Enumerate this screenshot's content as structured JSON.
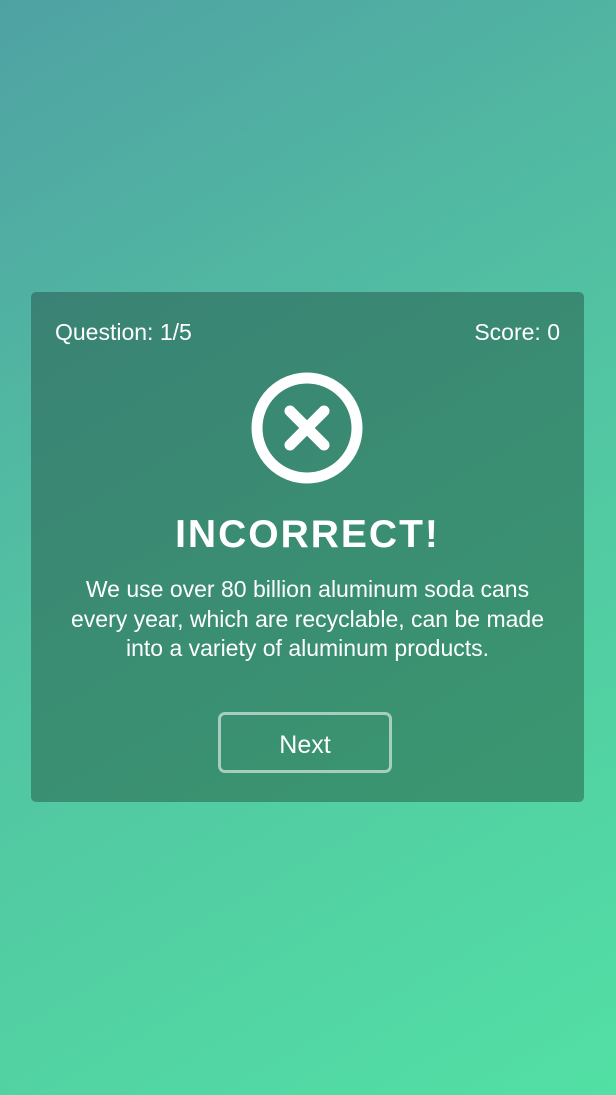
{
  "header": {
    "question_label": "Question: 1/5",
    "score_label": "Score: 0"
  },
  "result": {
    "icon": "close-circle-icon",
    "title": "INCORRECT!",
    "message": "We use over 80 billion aluminum soda cans every year, which are recyclable, can be made into a variety of aluminum products."
  },
  "actions": {
    "next_label": "Next"
  },
  "colors": {
    "background_start": "#4fa2a3",
    "background_end": "#52e0a4",
    "card": "#3a8d72",
    "text": "#ffffff"
  }
}
